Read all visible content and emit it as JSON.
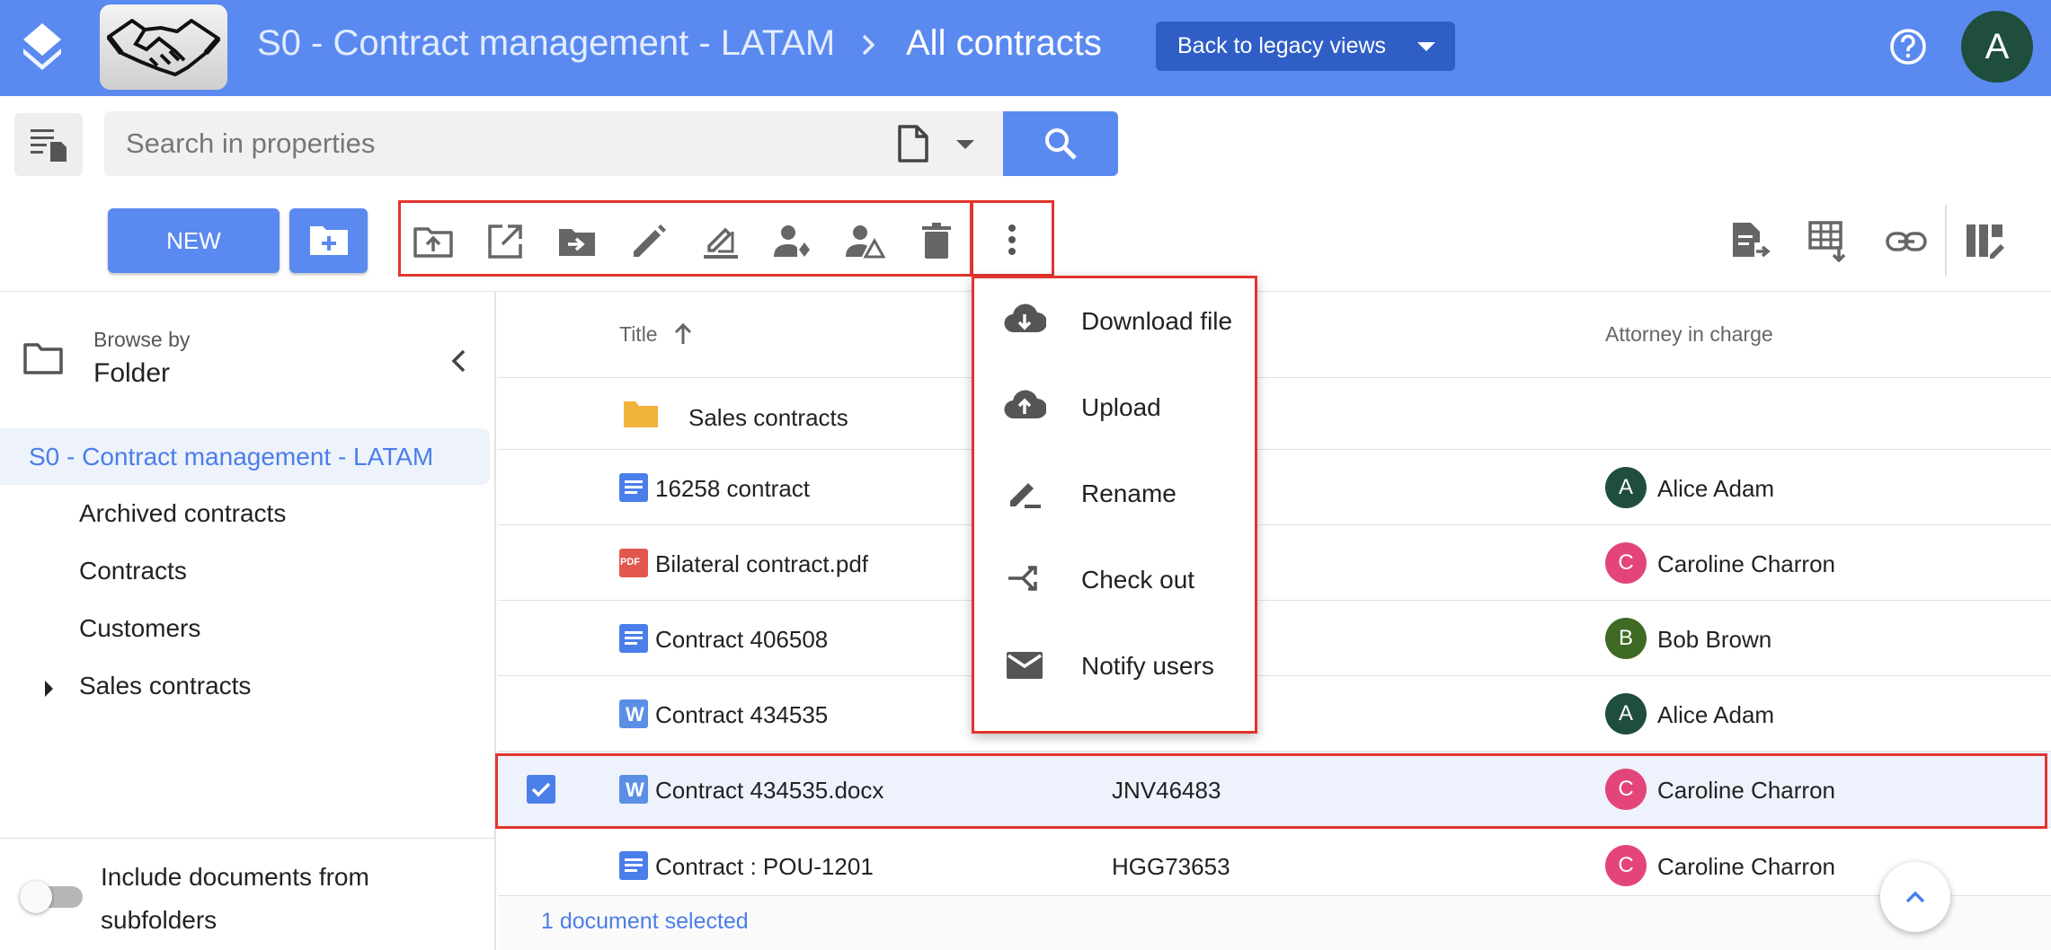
{
  "header": {
    "space_name": "S0 - Contract management - LATAM",
    "current_view": "All contracts",
    "legacy_button": "Back to legacy views",
    "user_initial": "A"
  },
  "search": {
    "placeholder": "Search in properties"
  },
  "toolbar": {
    "new_label": "NEW"
  },
  "sidebar": {
    "browse_by_label": "Browse by",
    "browse_by_value": "Folder",
    "active_item": "S0 - Contract management - LATAM",
    "items": [
      {
        "label": "Archived contracts"
      },
      {
        "label": "Contracts"
      },
      {
        "label": "Customers"
      },
      {
        "label": "Sales contracts"
      }
    ],
    "include_subfolders_label": "Include documents from subfolders"
  },
  "table": {
    "columns": {
      "title": "Title",
      "attorney": "Attorney in charge"
    },
    "rows": [
      {
        "title": "Sales contracts",
        "type": "folder",
        "ref": "",
        "attorney": "",
        "initial": ""
      },
      {
        "title": "16258 contract",
        "type": "doc",
        "ref": "",
        "attorney": "Alice Adam",
        "initial": "A",
        "color": "#1f4e3d"
      },
      {
        "title": "Bilateral contract.pdf",
        "type": "pdf",
        "ref": "",
        "attorney": "Caroline Charron",
        "initial": "C",
        "color": "#e3457a"
      },
      {
        "title": "Contract 406508",
        "type": "doc",
        "ref": "",
        "attorney": "Bob Brown",
        "initial": "B",
        "color": "#3e6a24"
      },
      {
        "title": "Contract 434535",
        "type": "word",
        "ref": "",
        "attorney": "Alice Adam",
        "initial": "A",
        "color": "#1f4e3d"
      },
      {
        "title": "Contract 434535.docx",
        "type": "word",
        "ref": "JNV46483",
        "attorney": "Caroline Charron",
        "initial": "C",
        "color": "#e3457a",
        "selected": true
      },
      {
        "title": "Contract : POU-1201",
        "type": "doc",
        "ref": "HGG73653",
        "attorney": "Caroline Charron",
        "initial": "C",
        "color": "#e3457a"
      }
    ],
    "pdf_badge": "PDF",
    "word_badge": "W",
    "status": "1 document selected"
  },
  "menu": {
    "items": [
      {
        "label": "Download file",
        "icon": "cloud-download-icon"
      },
      {
        "label": "Upload",
        "icon": "cloud-upload-icon"
      },
      {
        "label": "Rename",
        "icon": "rename-icon"
      },
      {
        "label": "Check out",
        "icon": "check-out-icon"
      },
      {
        "label": "Notify users",
        "icon": "mail-icon"
      }
    ]
  },
  "colors": {
    "header_bg": "#5a8af0",
    "accent": "#4a7ee9",
    "highlight": "#e3342f"
  }
}
